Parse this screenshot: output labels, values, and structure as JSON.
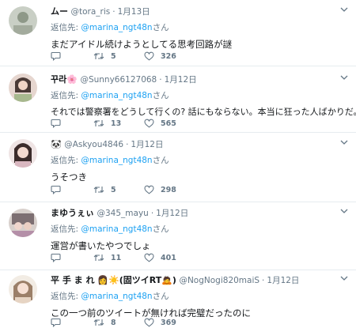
{
  "colors": {
    "link": "#1da1f2",
    "muted": "#657786",
    "divider": "#e6ecf0"
  },
  "icons": {
    "reply": "speech-bubble-icon",
    "retweet": "retweet-icon",
    "like": "heart-icon",
    "menu": "chevron-down-icon"
  },
  "tweets": [
    {
      "name": "ムー",
      "emoji": "",
      "handle": "@tora_ris",
      "dot": "·",
      "date": "1月13日",
      "reply_prefix": "返信先: ",
      "reply_to": "@marina_ngt48n",
      "reply_suffix": "さん",
      "text": "まだアイドル続けようとしてる思考回路が謎",
      "retweets": "5",
      "likes": "326"
    },
    {
      "name": "꾸라",
      "emoji": "🌸",
      "handle": "@Sunny66127068",
      "dot": "·",
      "date": "1月12日",
      "reply_prefix": "返信先: ",
      "reply_to": "@marina_ngt48n",
      "reply_suffix": "さん",
      "text": "それでは警察署をどうして行くの? 話にもならない。本当に狂った人ばかりだ。",
      "retweets": "13",
      "likes": "565"
    },
    {
      "name": "",
      "emoji": "🐼",
      "handle": "@Askyou4846",
      "dot": "·",
      "date": "1月12日",
      "reply_prefix": "返信先: ",
      "reply_to": "@marina_ngt48n",
      "reply_suffix": "さん",
      "text": "うそつき",
      "retweets": "5",
      "likes": "298"
    },
    {
      "name": "まゆうぇぃ",
      "emoji": "",
      "handle": "@345_mayu",
      "dot": "·",
      "date": "1月12日",
      "reply_prefix": "返信先: ",
      "reply_to": "@marina_ngt48n",
      "reply_suffix": "さん",
      "text": "運営が書いたやつでしょ",
      "retweets": "11",
      "likes": "401"
    },
    {
      "name": "平 手 ま れ 👩☀️(固ツイRT🙇)",
      "emoji": "",
      "handle": "@NogNogi820maiS",
      "dot": "·",
      "date": "1月12日",
      "reply_prefix": "返信先: ",
      "reply_to": "@marina_ngt48n",
      "reply_suffix": "さん",
      "text": "この一つ前のツイートが無ければ完璧だったのに",
      "retweets": "8",
      "likes": "369"
    }
  ]
}
